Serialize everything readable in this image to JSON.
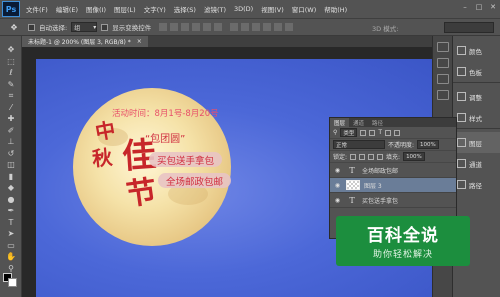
{
  "app": {
    "logo": "Ps"
  },
  "menu": {
    "items": [
      "文件(F)",
      "编辑(E)",
      "图像(I)",
      "图层(L)",
      "文字(Y)",
      "选择(S)",
      "滤镜(T)",
      "3D(D)",
      "视图(V)",
      "窗口(W)",
      "帮助(H)"
    ]
  },
  "window_controls": {
    "minimize": "–",
    "maximize": "□",
    "close": "✕"
  },
  "options": {
    "tool_icon": "move-tool-icon",
    "auto_select_label": "自动选择:",
    "auto_select_value": "组",
    "show_transform_label": "显示变换控件",
    "mode_3d": "3D 模式:"
  },
  "document": {
    "tab_title": "未标题-1 @ 200% (图层 3, RGB/8) *",
    "tab_close": "×"
  },
  "canvas": {
    "event_time": "活动时间：8月1号-8月20号",
    "callig_1": "中",
    "callig_2": "秋",
    "callig_3": "佳",
    "callig_4": "节",
    "tag_title": "“包团圆”",
    "pill_1": "买包送手拿包",
    "pill_2": "全场邮政包邮",
    "colors": {
      "bg": "#4c68d8",
      "moon": "#f5e2a8",
      "accent_red": "#c7262a",
      "pill_text": "#d02c3f"
    }
  },
  "right_panel": {
    "items": [
      {
        "label": "颜色",
        "icon": "color-icon"
      },
      {
        "label": "色板",
        "icon": "swatches-icon"
      },
      {
        "label": "调整",
        "icon": "adjustments-icon"
      },
      {
        "label": "样式",
        "icon": "styles-icon"
      },
      {
        "label": "图层",
        "icon": "layers-icon"
      },
      {
        "label": "通道",
        "icon": "channels-icon"
      },
      {
        "label": "路径",
        "icon": "paths-icon"
      }
    ]
  },
  "layers_panel": {
    "tabs": [
      "图层",
      "通道",
      "路径"
    ],
    "filter_kind": "类型",
    "blend_mode": "正常",
    "opacity_label": "不透明度:",
    "opacity_value": "100%",
    "lock_label": "锁定:",
    "fill_label": "填充:",
    "fill_value": "100%",
    "layers": [
      {
        "name": "全场邮政包邮",
        "type": "text",
        "thumb": "T"
      },
      {
        "name": "图层 3",
        "type": "pixel",
        "selected": true
      },
      {
        "name": "买包送手拿包",
        "type": "text",
        "thumb": "T"
      }
    ]
  },
  "watermark": {
    "line1": "百科全说",
    "line2": "助你轻松解决"
  }
}
